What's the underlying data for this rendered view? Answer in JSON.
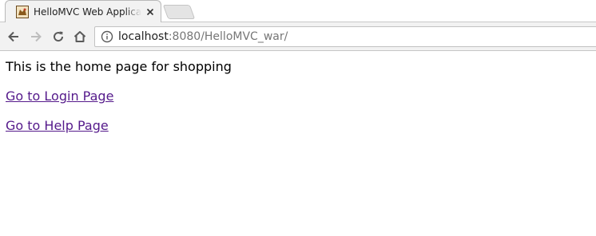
{
  "browser": {
    "tab": {
      "title": "HelloMVC Web Application",
      "close_glyph": "×"
    },
    "address_bar": {
      "host": "localhost",
      "rest": ":8080/HelloMVC_war/"
    },
    "icons": {
      "back": "back-arrow-icon",
      "forward": "forward-arrow-icon",
      "reload": "reload-icon",
      "home": "home-icon",
      "site_info": "info-icon",
      "favicon": "tomcat-favicon-icon"
    }
  },
  "page": {
    "intro": "This is the home page for shopping",
    "links": [
      {
        "label": "Go to Login Page"
      },
      {
        "label": "Go to Help Page"
      }
    ],
    "link_color": "#551a8b"
  }
}
